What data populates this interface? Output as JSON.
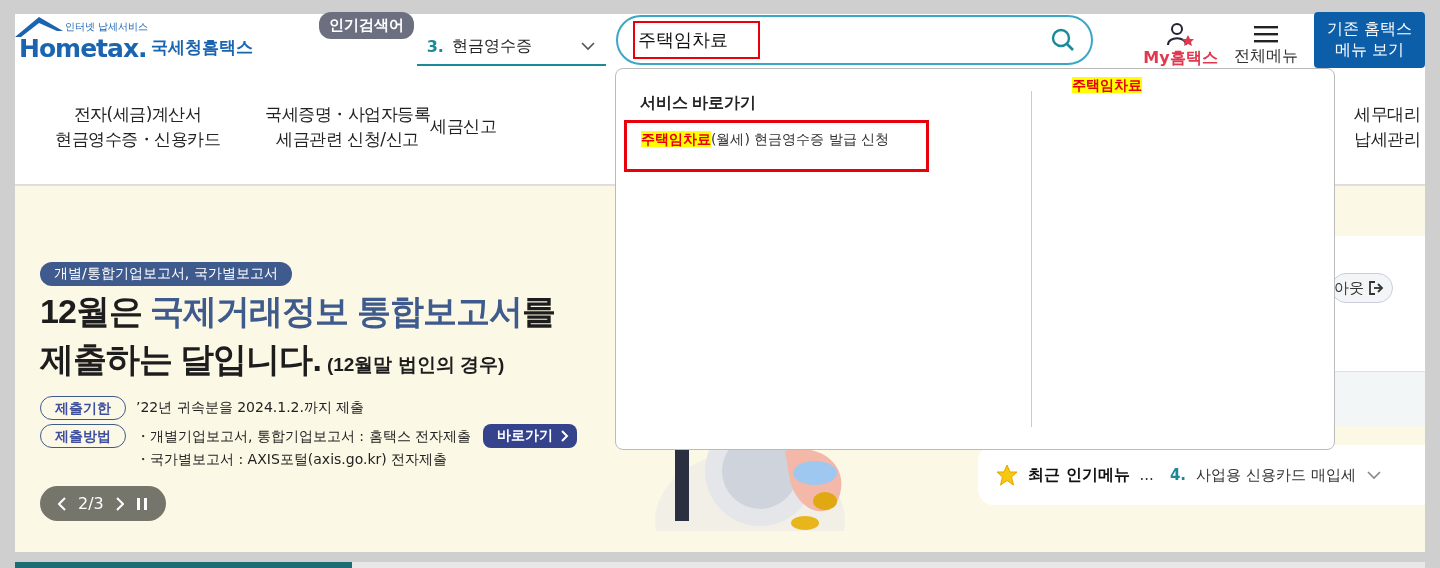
{
  "logo": {
    "tagline": "인터넷 납세서비스",
    "wordmark": "Hometax.",
    "name": "국세청홈택스"
  },
  "popular": {
    "label": "인기검색어",
    "rank": "3.",
    "value": "현금영수증"
  },
  "search": {
    "value": "주택임차료",
    "annotated": true
  },
  "header_links": [
    {
      "kind": "my",
      "label": "My홈택스"
    },
    {
      "kind": "menu",
      "label": "전체메뉴"
    }
  ],
  "legacy_button": {
    "lines": [
      "기존 홈택스",
      "메뉴 보기"
    ]
  },
  "nav": [
    {
      "lines": [
        "전자(세금)계산서",
        "현금영수증・신용카드"
      ]
    },
    {
      "lines": [
        "국세증명・사업자등록",
        "세금관련 신청/신고"
      ]
    },
    {
      "lines": [
        "세금신고"
      ]
    },
    {
      "lines": [
        "세무대리",
        "납세관리"
      ]
    }
  ],
  "suggest_panel": {
    "heading": "서비스 바로가기",
    "items": [
      {
        "parts": [
          {
            "text": "주택임차료",
            "highlight": true
          },
          {
            "text": "(월세) 현금영수증 발급 신청",
            "highlight": false
          }
        ],
        "annotated": true
      }
    ],
    "keywords": [
      {
        "text": "주택임차료",
        "highlight": true
      }
    ]
  },
  "banner": {
    "tag": "개별/통합기업보고서, 국가별보고서",
    "headline": [
      [
        {
          "text": "12월은 ",
          "accent": false
        },
        {
          "text": "국제거래정보 통합보고서",
          "accent": true
        },
        {
          "text": "를",
          "accent": false
        }
      ],
      [
        {
          "text": "제출하는 달입니다.",
          "accent": false
        }
      ]
    ],
    "subtitle": "(12월말 법인의 경우)",
    "rows": [
      {
        "label": "제출기한",
        "lines": [
          "’22년 귀속분을 2024.1.2.까지 제출"
        ]
      },
      {
        "label": "제출방법",
        "lines": [
          "・개별기업보고서, 통합기업보고서 : 홈택스 전자제출",
          "・국가별보고서 : AXIS포털(axis.go.kr) 전자제출"
        ]
      }
    ],
    "go_button": "바로가기",
    "carousel": {
      "counter": "2/3",
      "playing": true
    }
  },
  "side": {
    "logout_label": "아웃"
  },
  "recent": {
    "title": "최근 인기메뉴",
    "ellipsis": "...",
    "rank": "4.",
    "value": "사업용 신용카드 매입세"
  }
}
